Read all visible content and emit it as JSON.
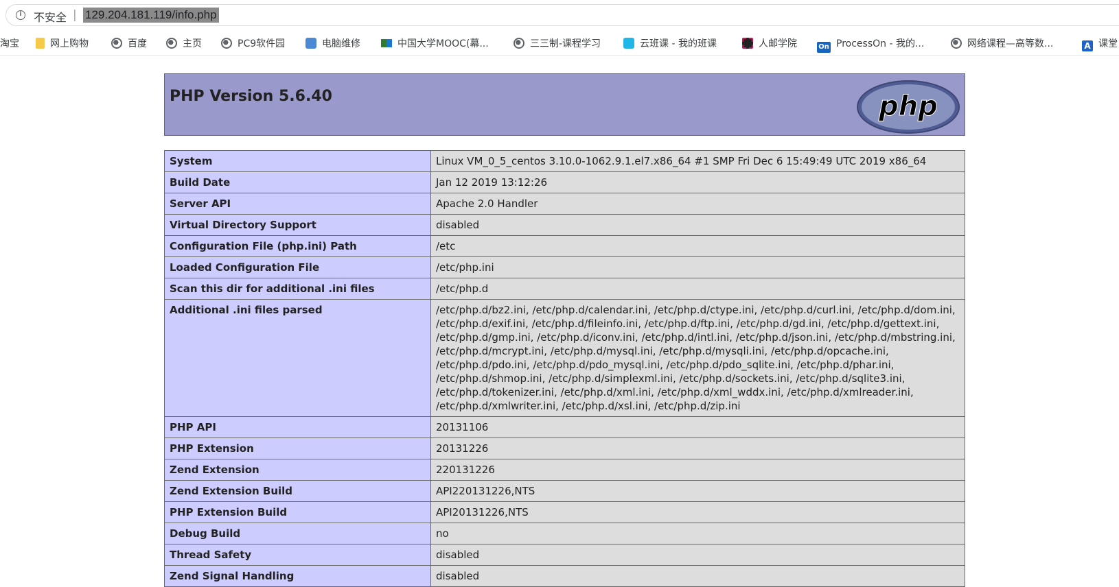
{
  "browser": {
    "security_label": "不安全",
    "url": "129.204.181.119/info.php"
  },
  "bookmarks": [
    {
      "label": "淘宝",
      "icon": "none"
    },
    {
      "label": "网上购物",
      "icon": "folder-icon"
    },
    {
      "label": "百度",
      "icon": "globe-icon"
    },
    {
      "label": "主页",
      "icon": "globe-icon"
    },
    {
      "label": "PC9软件园",
      "icon": "globe-icon"
    },
    {
      "label": "电脑维修",
      "icon": "person-icon"
    },
    {
      "label": "中国大学MOOC(幕...",
      "icon": "mooc-icon"
    },
    {
      "label": "三三制-课程学习",
      "icon": "globe-icon"
    },
    {
      "label": "云班课 - 我的班课",
      "icon": "cloud-icon"
    },
    {
      "label": "人邮学院",
      "icon": "film-icon"
    },
    {
      "label": "ProcessOn - 我的...",
      "icon": "on-icon"
    },
    {
      "label": "网络课程—高等数...",
      "icon": "globe-icon"
    },
    {
      "label": "课堂",
      "icon": "a-icon"
    }
  ],
  "php": {
    "title": "PHP Version 5.6.40",
    "logo_text": "php",
    "rows": [
      {
        "key": "System",
        "value": "Linux VM_0_5_centos 3.10.0-1062.9.1.el7.x86_64 #1 SMP Fri Dec 6 15:49:49 UTC 2019 x86_64"
      },
      {
        "key": "Build Date",
        "value": "Jan 12 2019 13:12:26"
      },
      {
        "key": "Server API",
        "value": "Apache 2.0 Handler"
      },
      {
        "key": "Virtual Directory Support",
        "value": "disabled"
      },
      {
        "key": "Configuration File (php.ini) Path",
        "value": "/etc"
      },
      {
        "key": "Loaded Configuration File",
        "value": "/etc/php.ini"
      },
      {
        "key": "Scan this dir for additional .ini files",
        "value": "/etc/php.d"
      },
      {
        "key": "Additional .ini files parsed",
        "value": "/etc/php.d/bz2.ini, /etc/php.d/calendar.ini, /etc/php.d/ctype.ini, /etc/php.d/curl.ini, /etc/php.d/dom.ini, /etc/php.d/exif.ini, /etc/php.d/fileinfo.ini, /etc/php.d/ftp.ini, /etc/php.d/gd.ini, /etc/php.d/gettext.ini, /etc/php.d/gmp.ini, /etc/php.d/iconv.ini, /etc/php.d/intl.ini, /etc/php.d/json.ini, /etc/php.d/mbstring.ini, /etc/php.d/mcrypt.ini, /etc/php.d/mysql.ini, /etc/php.d/mysqli.ini, /etc/php.d/opcache.ini, /etc/php.d/pdo.ini, /etc/php.d/pdo_mysql.ini, /etc/php.d/pdo_sqlite.ini, /etc/php.d/phar.ini, /etc/php.d/shmop.ini, /etc/php.d/simplexml.ini, /etc/php.d/sockets.ini, /etc/php.d/sqlite3.ini, /etc/php.d/tokenizer.ini, /etc/php.d/xml.ini, /etc/php.d/xml_wddx.ini, /etc/php.d/xmlreader.ini, /etc/php.d/xmlwriter.ini, /etc/php.d/xsl.ini, /etc/php.d/zip.ini"
      },
      {
        "key": "PHP API",
        "value": "20131106"
      },
      {
        "key": "PHP Extension",
        "value": "20131226"
      },
      {
        "key": "Zend Extension",
        "value": "220131226"
      },
      {
        "key": "Zend Extension Build",
        "value": "API220131226,NTS"
      },
      {
        "key": "PHP Extension Build",
        "value": "API20131226,NTS"
      },
      {
        "key": "Debug Build",
        "value": "no"
      },
      {
        "key": "Thread Safety",
        "value": "disabled"
      },
      {
        "key": "Zend Signal Handling",
        "value": "disabled"
      }
    ]
  },
  "colors": {
    "header_bg": "#9999cc",
    "key_bg": "#ccccff",
    "value_bg": "#dddddd"
  }
}
